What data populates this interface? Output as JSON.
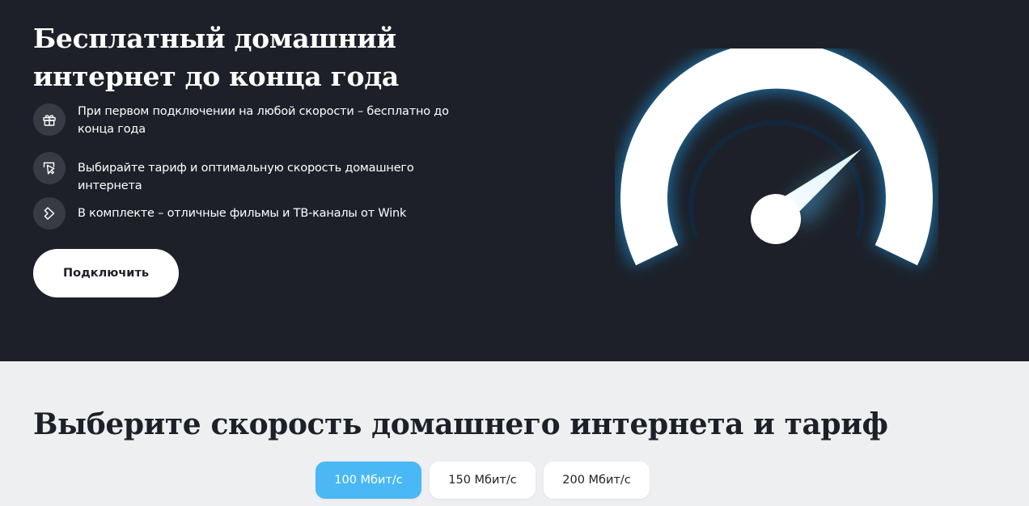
{
  "hero": {
    "title": "Бесплатный домашний интернет до конца года",
    "features": [
      {
        "icon": "gift-icon",
        "text": "При первом подключении на любой скорости – бесплатно до конца года"
      },
      {
        "icon": "cursor-click-icon",
        "text": "Выбирайте тариф и оптимальную скорость домашнего интернета"
      },
      {
        "icon": "wink-play-icon",
        "text": "В комплекте – отличные фильмы и ТВ-каналы от Wink"
      }
    ],
    "cta_label": "Подключить",
    "illustration": "speedometer-icon"
  },
  "tariffs": {
    "title": "Выберите скорость домашнего интернета и тариф",
    "speeds": [
      {
        "label": "100 Мбит/с",
        "active": true
      },
      {
        "label": "150 Мбит/с",
        "active": false
      },
      {
        "label": "200 Мбит/с",
        "active": false
      }
    ]
  },
  "colors": {
    "hero_bg": "#1d2028",
    "page_bg": "#eeeff1",
    "accent": "#49b8f5",
    "icon_circle": "#383b44"
  }
}
